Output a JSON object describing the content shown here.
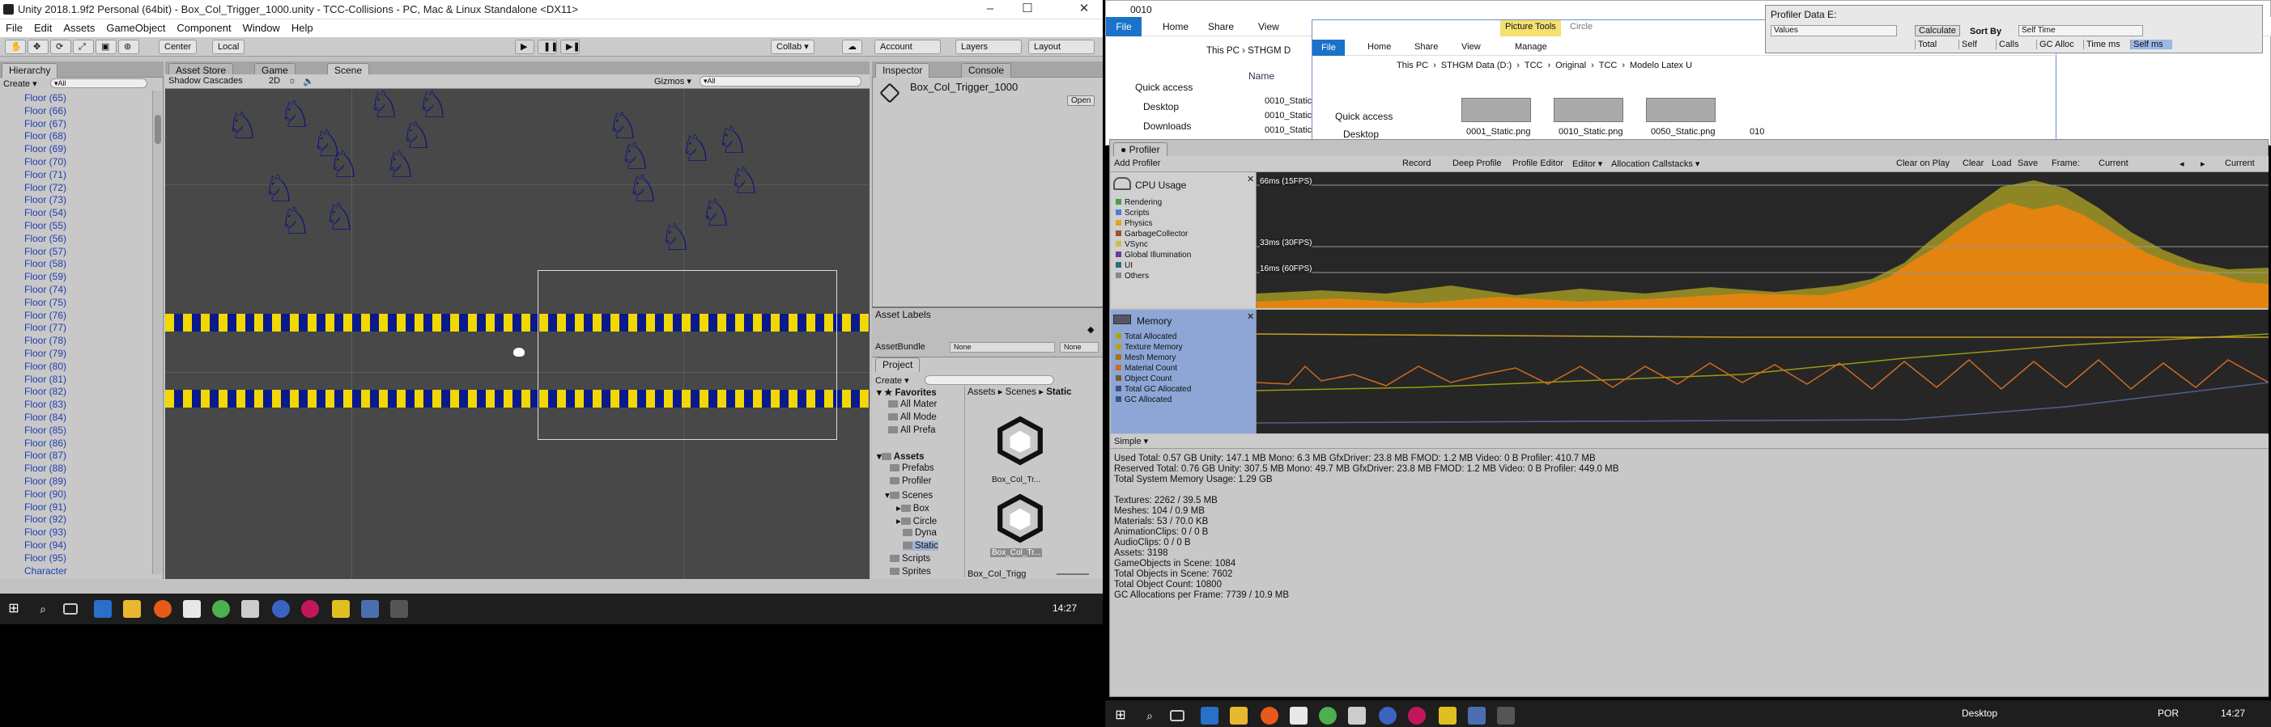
{
  "unity": {
    "title": "Unity 2018.1.9f2 Personal (64bit) - Box_Col_Trigger_1000.unity - TCC-Collisions - PC, Mac & Linux Standalone <DX11>",
    "menu": [
      "File",
      "Edit",
      "Assets",
      "GameObject",
      "Component",
      "Window",
      "Help"
    ],
    "toolbar": {
      "pivot": "Center",
      "space": "Local",
      "collab": "Collab ▾",
      "account": "Account",
      "layers": "Layers",
      "layout": "Layout"
    },
    "hierarchy": {
      "tab": "Hierarchy",
      "create": "Create ▾",
      "search_placeholder": "▾All",
      "items": [
        "Floor (65)",
        "Floor (66)",
        "Floor (67)",
        "Floor (68)",
        "Floor (69)",
        "Floor (70)",
        "Floor (71)",
        "Floor (72)",
        "Floor (73)",
        "Floor (54)",
        "Floor (55)",
        "Floor (56)",
        "Floor (57)",
        "Floor (58)",
        "Floor (59)",
        "Floor (74)",
        "Floor (75)",
        "Floor (76)",
        "Floor (77)",
        "Floor (78)",
        "Floor (79)",
        "Floor (80)",
        "Floor (81)",
        "Floor (82)",
        "Floor (83)",
        "Floor (84)",
        "Floor (85)",
        "Floor (86)",
        "Floor (87)",
        "Floor (88)",
        "Floor (89)",
        "Floor (90)",
        "Floor (91)",
        "Floor (92)",
        "Floor (93)",
        "Floor (94)",
        "Floor (95)",
        "Character"
      ]
    },
    "scene": {
      "tabs": [
        "Asset Store",
        "Game",
        "Scene"
      ],
      "shading": "Shadow Cascades",
      "mode2d": "2D",
      "gizmos": "Gizmos ▾",
      "search": "▾All"
    },
    "inspector": {
      "tab": "Inspector",
      "console": "Console",
      "object": "Box_Col_Trigger_1000",
      "open": "Open"
    },
    "asset_labels": {
      "title": "Asset Labels",
      "bundle_label": "AssetBundle",
      "bundle_value": "None",
      "variant": "None"
    },
    "project": {
      "tab": "Project",
      "create": "Create ▾",
      "favorites": [
        "Favorites",
        "All Mater",
        "All Mode",
        "All Prefa"
      ],
      "assets": [
        "Assets",
        "Prefabs",
        "Profiler",
        "Scenes",
        "Box",
        "Circle",
        "Dyna",
        "Static",
        "Scripts",
        "Sprites"
      ],
      "breadcrumb": [
        "Assets",
        "Scenes",
        "Static"
      ],
      "files": [
        "Box_Col_Tr...",
        "Box_Col_Tr..."
      ],
      "footer": "Box_Col_Trigg"
    }
  },
  "taskbar": {
    "time": "14:27",
    "lang": "POR",
    "desktop": "Desktop"
  },
  "explorer": {
    "title": "0010",
    "ribbon": [
      "File",
      "Home",
      "Share",
      "View"
    ],
    "path": "This PC › STHGM D",
    "quick": [
      "Quick access",
      "Desktop",
      "Downloads"
    ],
    "name_header": "Name",
    "files": [
      "0010_Static",
      "0010_Static",
      "0010_Static"
    ]
  },
  "explorer2": {
    "picture_tools": "Picture Tools",
    "title": "Circle",
    "ribbon": [
      "File",
      "Home",
      "Share",
      "View",
      "Manage"
    ],
    "path": [
      "This PC",
      "STHGM Data (D:)",
      "TCC",
      "Original",
      "TCC",
      "Modelo Latex U"
    ],
    "quick": [
      "Quick access",
      "Desktop"
    ],
    "thumbs": [
      "0001_Static.png",
      "0010_Static.png",
      "0050_Static.png",
      "010"
    ]
  },
  "profiler_data": {
    "title": "Profiler Data E:",
    "values": "Values",
    "calculate": "Calculate",
    "sort_by": "Sort By",
    "self_time": "Self Time",
    "headers": [
      "Total",
      "Self",
      "Calls",
      "GC Alloc",
      "Time ms",
      "Self ms"
    ]
  },
  "profiler": {
    "tab": "Profiler",
    "add": "Add Profiler",
    "toolbar": [
      "Record",
      "Deep Profile",
      "Profile Editor",
      "Editor ▾",
      "Allocation Callstacks ▾"
    ],
    "right": [
      "Clear on Play",
      "Clear",
      "Load",
      "Save",
      "Frame:",
      "Current",
      "Current"
    ],
    "cpu": {
      "title": "CPU Usage",
      "legend": [
        "Rendering",
        "Scripts",
        "Physics",
        "GarbageCollector",
        "VSync",
        "Global Illumination",
        "UI",
        "Others"
      ],
      "colors": [
        "#4a9e43",
        "#4c7bd8",
        "#d8a72a",
        "#9a5230",
        "#c8c24a",
        "#6d3a9a",
        "#2c6d80",
        "#888888"
      ],
      "labels": [
        "66ms (15FPS)",
        "33ms (30FPS)",
        "16ms (60FPS)"
      ]
    },
    "memory": {
      "title": "Memory",
      "legend": [
        "Total Allocated",
        "Texture Memory",
        "Mesh Memory",
        "Material Count",
        "Object Count",
        "Total GC Allocated",
        "GC Allocated"
      ],
      "colors": [
        "#a8a800",
        "#c0a010",
        "#b07018",
        "#d06a20",
        "#706030",
        "#405080",
        "#305890"
      ]
    },
    "mode": "Simple ▾",
    "stats": [
      "Used Total: 0.57 GB   Unity: 147.1 MB   Mono: 6.3 MB   GfxDriver: 23.8 MB   FMOD: 1.2 MB   Video: 0 B   Profiler: 410.7 MB",
      "Reserved Total: 0.76 GB   Unity: 307.5 MB   Mono: 49.7 MB   GfxDriver: 23.8 MB   FMOD: 1.2 MB   Video: 0 B   Profiler: 449.0 MB",
      "Total System Memory Usage: 1.29 GB",
      "",
      "Textures: 2262 / 39.5 MB",
      "Meshes: 104 / 0.9 MB",
      "Materials: 53 / 70.0 KB",
      "AnimationClips: 0 / 0 B",
      "AudioClips: 0 / 0 B",
      "Assets: 3198",
      "GameObjects in Scene: 1084",
      "Total Objects in Scene: 7602",
      "Total Object Count: 10800",
      "GC Allocations per Frame: 7739 / 10.9 MB"
    ]
  }
}
